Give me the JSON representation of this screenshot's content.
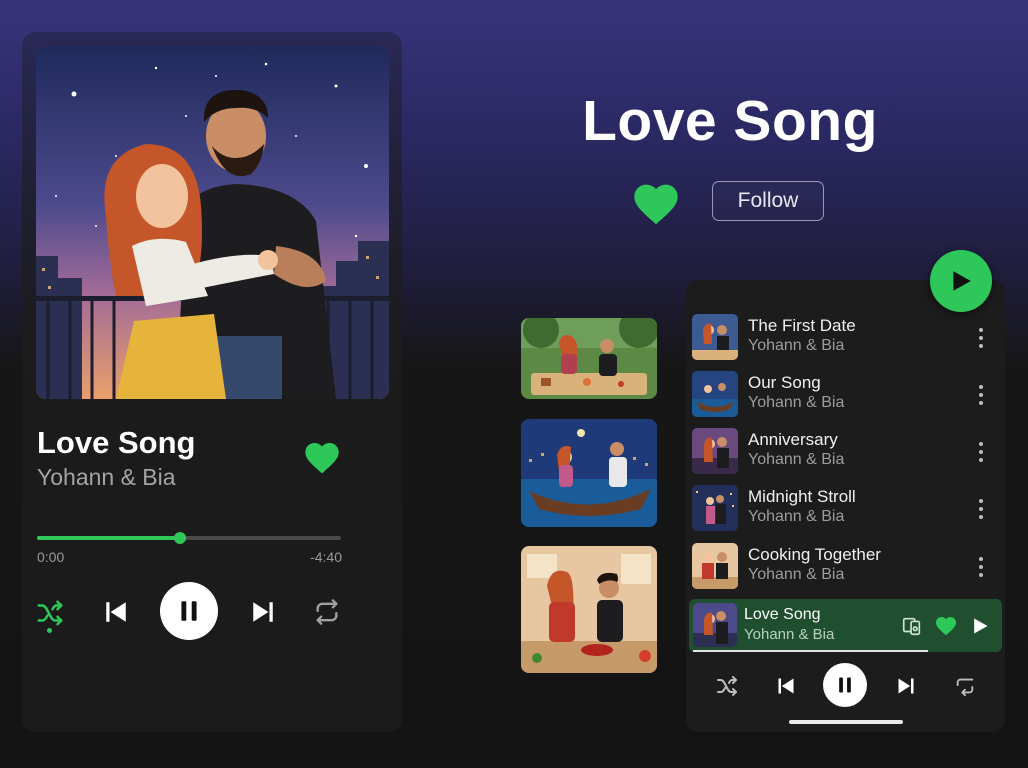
{
  "header": {
    "title": "Love Song",
    "follow_label": "Follow"
  },
  "player": {
    "title": "Love Song",
    "artist": "Yohann & Bia",
    "liked": true,
    "progress_fraction": 0.47,
    "time_elapsed": "0:00",
    "time_remaining": "-4:40",
    "controls": [
      "shuffle-icon",
      "previous-icon",
      "pause-icon",
      "next-icon",
      "repeat-icon"
    ]
  },
  "thumbnails": [
    "picnic-scene",
    "boat-scene",
    "cooking-scene"
  ],
  "playlist": {
    "tracks": [
      {
        "title": "The First Date",
        "artist": "Yohann & Bia"
      },
      {
        "title": "Our Song",
        "artist": "Yohann & Bia"
      },
      {
        "title": "Anniversary",
        "artist": "Yohann & Bia"
      },
      {
        "title": "Midnight Stroll",
        "artist": "Yohann & Bia"
      },
      {
        "title": "Cooking Together",
        "artist": "Yohann & Bia"
      }
    ],
    "now_playing": {
      "title": "Love Song",
      "artist": "Yohann & Bia",
      "progress_fraction": 0.75
    }
  },
  "colors": {
    "accent": "#2ec759",
    "now_playing_bg": "#1f4f2e",
    "background_top": "#37347a",
    "background_bottom": "#141414"
  }
}
